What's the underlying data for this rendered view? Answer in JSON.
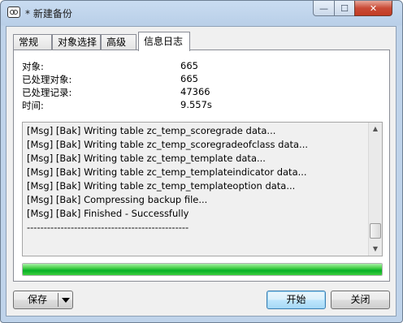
{
  "window": {
    "title": "* 新建备份",
    "controls": {
      "minimize": "—",
      "maximize": "☐",
      "close": "✕"
    }
  },
  "tabs": [
    {
      "label": "常规",
      "active": false
    },
    {
      "label": "对象选择",
      "active": false
    },
    {
      "label": "高级",
      "active": false
    },
    {
      "label": "信息日志",
      "active": true
    }
  ],
  "stats": [
    {
      "label": "对象:",
      "value": "665"
    },
    {
      "label": "已处理对象:",
      "value": "665"
    },
    {
      "label": "已处理记录:",
      "value": "47366"
    },
    {
      "label": "时间:",
      "value": "9.557s"
    }
  ],
  "log": {
    "lines": [
      "[Msg] [Bak] Writing table zc_temp_scoregrade data...",
      "[Msg] [Bak] Writing table zc_temp_scoregradeofclass data...",
      "[Msg] [Bak] Writing table zc_temp_template data...",
      "[Msg] [Bak] Writing table zc_temp_templateindicator data...",
      "[Msg] [Bak] Writing table zc_temp_templateoption data...",
      "[Msg] [Bak] Compressing backup file...",
      "[Msg] [Bak] Finished - Successfully",
      "------------------------------------------------"
    ],
    "scroll_up": "▲",
    "scroll_down": "▼"
  },
  "progress": {
    "percent": 100,
    "color": "#06b025"
  },
  "buttons": {
    "save": "保存",
    "start": "开始",
    "close": "关闭"
  },
  "colors": {
    "title_bar": "#bfd3ea",
    "close_control": "#c94b36",
    "default_button_border": "#3c7fb1"
  }
}
